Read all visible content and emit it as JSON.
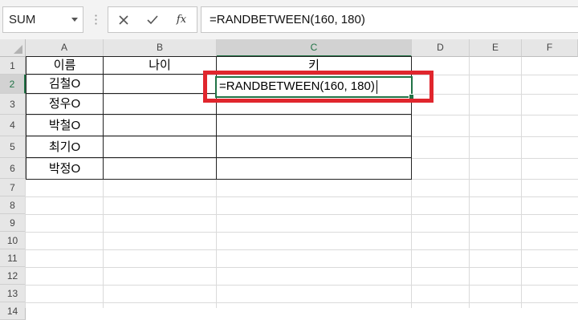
{
  "formula_bar": {
    "name_box": "SUM",
    "cancel_icon": "x-icon",
    "enter_icon": "checkmark-icon",
    "fx_label": "fx",
    "formula": "=RANDBETWEEN(160, 180)"
  },
  "columns": [
    "A",
    "B",
    "C",
    "D",
    "E",
    "F"
  ],
  "rows": [
    "1",
    "2",
    "3",
    "4",
    "5",
    "6",
    "7",
    "8",
    "9",
    "10",
    "11",
    "12",
    "13",
    "14"
  ],
  "active_cell": "C2",
  "table": {
    "headers": [
      "이름",
      "나이",
      "키"
    ],
    "names": [
      "김철O",
      "정우O",
      "박철O",
      "최기O",
      "박정O"
    ],
    "editing_value": "=RANDBETWEEN(160, 180)"
  },
  "colors": {
    "accent": "#217346",
    "highlight": "#e0262d"
  }
}
